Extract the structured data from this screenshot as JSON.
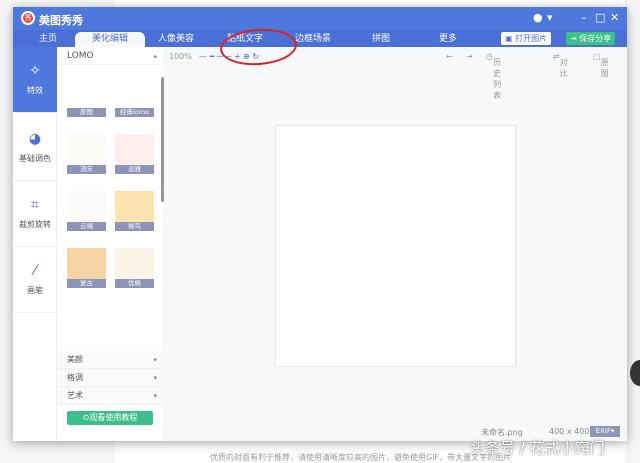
{
  "app": {
    "title": "美图秀秀",
    "logo_text": "秀"
  },
  "tabs": [
    {
      "label": "主页"
    },
    {
      "label": "美化编辑"
    },
    {
      "label": "人像美容"
    },
    {
      "label": "贴纸文字"
    },
    {
      "label": "边框场景"
    },
    {
      "label": "拼图"
    },
    {
      "label": "更多"
    }
  ],
  "buttons": {
    "open": "打开图片",
    "save": "保存分享",
    "tutorial": "⊙观看使用教程"
  },
  "sidebar": [
    {
      "label": "特效",
      "icon": "magic-wand"
    },
    {
      "label": "基础调色",
      "icon": "palette"
    },
    {
      "label": "裁剪旋转",
      "icon": "crop"
    },
    {
      "label": "画笔",
      "icon": "brush"
    }
  ],
  "panel": {
    "header": "LOMO",
    "filters": [
      {
        "label": "原图",
        "color": "#ffffff"
      },
      {
        "label": "经典lomo",
        "color": "#ffffff"
      },
      {
        "label": "流年",
        "color": "#fdfbf7"
      },
      {
        "label": "淡雅",
        "color": "#fdeeee"
      },
      {
        "label": "云端",
        "color": "#fbfaf8"
      },
      {
        "label": "候鸟",
        "color": "#fbe3b0"
      },
      {
        "label": "复古",
        "color": "#f6d4a6"
      },
      {
        "label": "优格",
        "color": "#faf3e8"
      }
    ],
    "categories": [
      "美颜",
      "格调",
      "艺术"
    ]
  },
  "toolbar": {
    "zoom": "100%",
    "history": "历史列表",
    "compare": "对比",
    "original": "原图"
  },
  "status": {
    "filename": "未命名.png",
    "size": "400 x 400",
    "exif": "EXIF"
  },
  "background": {
    "caption": "优质的封面有利于推荐，请使用清晰度较高的图片，避免使用GIF、带大量文字的图片",
    "watermark": "头条号 / 花式小窍门"
  }
}
